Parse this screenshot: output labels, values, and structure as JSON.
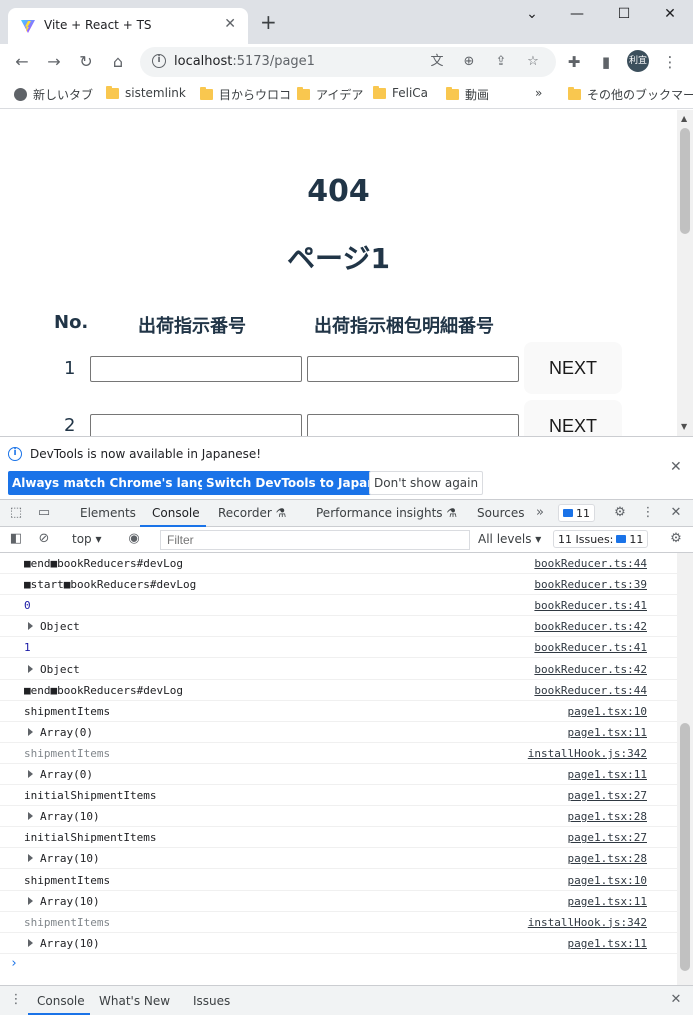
{
  "browser": {
    "tab_title": "Vite + React + TS",
    "url_host": "localhost",
    "url_path": ":5173/page1",
    "avatar_text": "利宜",
    "bookmarks": [
      {
        "label": "新しいタブ",
        "icon": "globe"
      },
      {
        "label": "sistemlink",
        "icon": "folder"
      },
      {
        "label": "目からウロコ",
        "icon": "folder"
      },
      {
        "label": "アイデア",
        "icon": "folder"
      },
      {
        "label": "FeliCa",
        "icon": "folder"
      },
      {
        "label": "動画",
        "icon": "folder"
      },
      {
        "label": "その他のブックマーク",
        "icon": "folder"
      }
    ]
  },
  "page": {
    "heading": "404",
    "subheading": "ページ1",
    "columns": [
      "No.",
      "出荷指示番号",
      "出荷指示梱包明細番号"
    ],
    "rows": [
      {
        "no": "1",
        "shipment_no": "",
        "detail_no": "",
        "button": "NEXT"
      },
      {
        "no": "2",
        "shipment_no": "",
        "detail_no": "",
        "button": "NEXT"
      }
    ]
  },
  "devtools": {
    "info_text": "DevTools is now available in Japanese!",
    "btn_match": "Always match Chrome's language",
    "btn_switch": "Switch DevTools to Japanese",
    "btn_dismiss": "Don't show again",
    "tabs": [
      "Elements",
      "Console",
      "Recorder",
      "Performance insights",
      "Sources"
    ],
    "active_tab": "Console",
    "issues_badge": "11",
    "context": "top",
    "filter_placeholder": "Filter",
    "levels": "All levels",
    "issues_label": "11 Issues:",
    "issues_count": "11",
    "console_rows": [
      {
        "msg": "■end■bookReducers#devLog",
        "src": "bookReducer.ts:44",
        "kind": "text"
      },
      {
        "msg": "■start■bookReducers#devLog",
        "src": "bookReducer.ts:39",
        "kind": "text"
      },
      {
        "msg": "0",
        "src": "bookReducer.ts:41",
        "kind": "num"
      },
      {
        "msg": "Object",
        "src": "bookReducer.ts:42",
        "kind": "expand"
      },
      {
        "msg": "1",
        "src": "bookReducer.ts:41",
        "kind": "num"
      },
      {
        "msg": "Object",
        "src": "bookReducer.ts:42",
        "kind": "expand"
      },
      {
        "msg": "■end■bookReducers#devLog",
        "src": "bookReducer.ts:44",
        "kind": "text"
      },
      {
        "msg": "shipmentItems",
        "src": "page1.tsx:10",
        "kind": "text"
      },
      {
        "msg": "Array(0)",
        "src": "page1.tsx:11",
        "kind": "expand"
      },
      {
        "msg": "shipmentItems",
        "src": "installHook.js:342",
        "kind": "muted"
      },
      {
        "msg": "Array(0)",
        "src": "page1.tsx:11",
        "kind": "expand"
      },
      {
        "msg": "initialShipmentItems",
        "src": "page1.tsx:27",
        "kind": "text"
      },
      {
        "msg": "Array(10)",
        "src": "page1.tsx:28",
        "kind": "expand"
      },
      {
        "msg": "initialShipmentItems",
        "src": "page1.tsx:27",
        "kind": "text"
      },
      {
        "msg": "Array(10)",
        "src": "page1.tsx:28",
        "kind": "expand"
      },
      {
        "msg": "shipmentItems",
        "src": "page1.tsx:10",
        "kind": "text"
      },
      {
        "msg": "Array(10)",
        "src": "page1.tsx:11",
        "kind": "expand"
      },
      {
        "msg": "shipmentItems",
        "src": "installHook.js:342",
        "kind": "muted"
      },
      {
        "msg": "Array(10)",
        "src": "page1.tsx:11",
        "kind": "expand"
      }
    ],
    "drawer_tabs": [
      "Console",
      "What's New",
      "Issues"
    ]
  }
}
